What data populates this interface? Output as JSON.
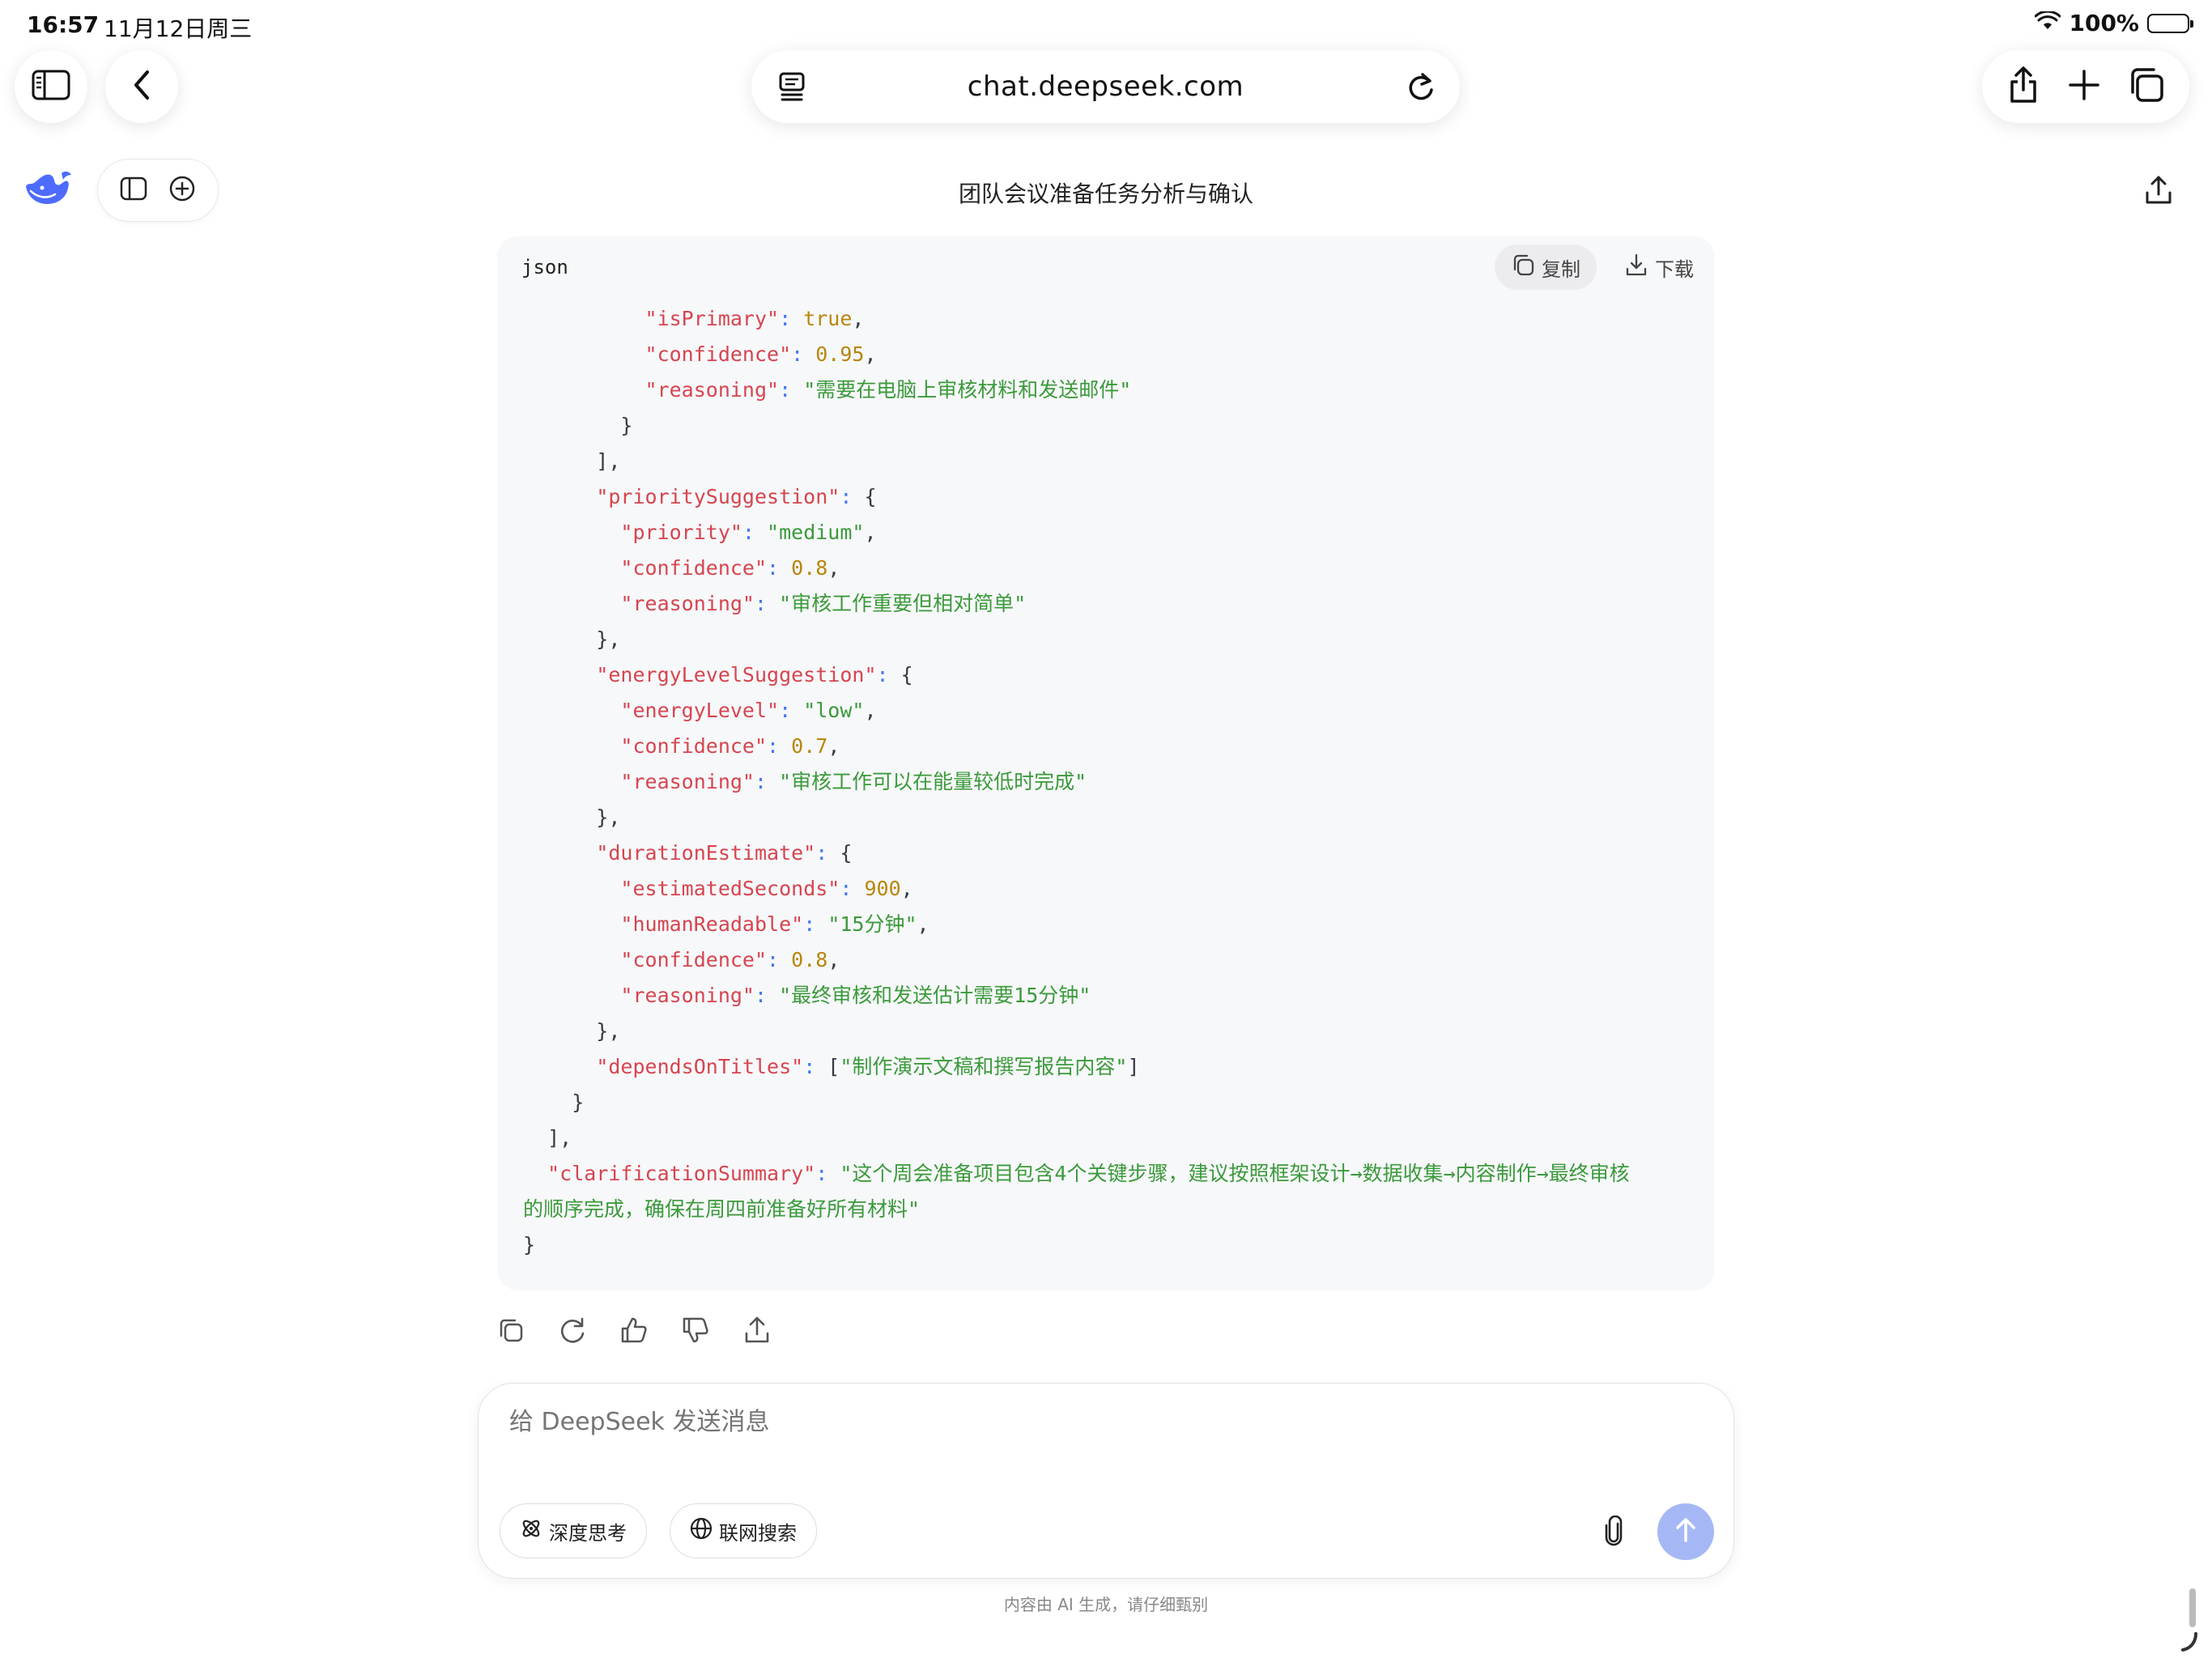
{
  "status_bar": {
    "time": "16:57",
    "date": "11月12日周三",
    "battery": "100%",
    "battery_level": 1.0
  },
  "browser": {
    "url": "chat.deepseek.com"
  },
  "chat": {
    "title": "团队会议准备任务分析与确认"
  },
  "code_block": {
    "language": "json",
    "copy_label": "复制",
    "download_label": "下载",
    "lines": [
      [
        {
          "t": "          ",
          "c": "p"
        },
        {
          "t": "\"isPrimary\"",
          "c": "k"
        },
        {
          "t": ": ",
          "c": "o"
        },
        {
          "t": "true",
          "c": "n"
        },
        {
          "t": ",",
          "c": "p"
        }
      ],
      [
        {
          "t": "          ",
          "c": "p"
        },
        {
          "t": "\"confidence\"",
          "c": "k"
        },
        {
          "t": ": ",
          "c": "o"
        },
        {
          "t": "0.95",
          "c": "n"
        },
        {
          "t": ",",
          "c": "p"
        }
      ],
      [
        {
          "t": "          ",
          "c": "p"
        },
        {
          "t": "\"reasoning\"",
          "c": "k"
        },
        {
          "t": ": ",
          "c": "o"
        },
        {
          "t": "\"需要在电脑上审核材料和发送邮件\"",
          "c": "s"
        }
      ],
      [
        {
          "t": "        }",
          "c": "p"
        }
      ],
      [
        {
          "t": "      ],",
          "c": "p"
        }
      ],
      [
        {
          "t": "      ",
          "c": "p"
        },
        {
          "t": "\"prioritySuggestion\"",
          "c": "k"
        },
        {
          "t": ": ",
          "c": "o"
        },
        {
          "t": "{",
          "c": "p"
        }
      ],
      [
        {
          "t": "        ",
          "c": "p"
        },
        {
          "t": "\"priority\"",
          "c": "k"
        },
        {
          "t": ": ",
          "c": "o"
        },
        {
          "t": "\"medium\"",
          "c": "s"
        },
        {
          "t": ",",
          "c": "p"
        }
      ],
      [
        {
          "t": "        ",
          "c": "p"
        },
        {
          "t": "\"confidence\"",
          "c": "k"
        },
        {
          "t": ": ",
          "c": "o"
        },
        {
          "t": "0.8",
          "c": "n"
        },
        {
          "t": ",",
          "c": "p"
        }
      ],
      [
        {
          "t": "        ",
          "c": "p"
        },
        {
          "t": "\"reasoning\"",
          "c": "k"
        },
        {
          "t": ": ",
          "c": "o"
        },
        {
          "t": "\"审核工作重要但相对简单\"",
          "c": "s"
        }
      ],
      [
        {
          "t": "      },",
          "c": "p"
        }
      ],
      [
        {
          "t": "      ",
          "c": "p"
        },
        {
          "t": "\"energyLevelSuggestion\"",
          "c": "k"
        },
        {
          "t": ": ",
          "c": "o"
        },
        {
          "t": "{",
          "c": "p"
        }
      ],
      [
        {
          "t": "        ",
          "c": "p"
        },
        {
          "t": "\"energyLevel\"",
          "c": "k"
        },
        {
          "t": ": ",
          "c": "o"
        },
        {
          "t": "\"low\"",
          "c": "s"
        },
        {
          "t": ",",
          "c": "p"
        }
      ],
      [
        {
          "t": "        ",
          "c": "p"
        },
        {
          "t": "\"confidence\"",
          "c": "k"
        },
        {
          "t": ": ",
          "c": "o"
        },
        {
          "t": "0.7",
          "c": "n"
        },
        {
          "t": ",",
          "c": "p"
        }
      ],
      [
        {
          "t": "        ",
          "c": "p"
        },
        {
          "t": "\"reasoning\"",
          "c": "k"
        },
        {
          "t": ": ",
          "c": "o"
        },
        {
          "t": "\"审核工作可以在能量较低时完成\"",
          "c": "s"
        }
      ],
      [
        {
          "t": "      },",
          "c": "p"
        }
      ],
      [
        {
          "t": "      ",
          "c": "p"
        },
        {
          "t": "\"durationEstimate\"",
          "c": "k"
        },
        {
          "t": ": ",
          "c": "o"
        },
        {
          "t": "{",
          "c": "p"
        }
      ],
      [
        {
          "t": "        ",
          "c": "p"
        },
        {
          "t": "\"estimatedSeconds\"",
          "c": "k"
        },
        {
          "t": ": ",
          "c": "o"
        },
        {
          "t": "900",
          "c": "n"
        },
        {
          "t": ",",
          "c": "p"
        }
      ],
      [
        {
          "t": "        ",
          "c": "p"
        },
        {
          "t": "\"humanReadable\"",
          "c": "k"
        },
        {
          "t": ": ",
          "c": "o"
        },
        {
          "t": "\"15分钟\"",
          "c": "s"
        },
        {
          "t": ",",
          "c": "p"
        }
      ],
      [
        {
          "t": "        ",
          "c": "p"
        },
        {
          "t": "\"confidence\"",
          "c": "k"
        },
        {
          "t": ": ",
          "c": "o"
        },
        {
          "t": "0.8",
          "c": "n"
        },
        {
          "t": ",",
          "c": "p"
        }
      ],
      [
        {
          "t": "        ",
          "c": "p"
        },
        {
          "t": "\"reasoning\"",
          "c": "k"
        },
        {
          "t": ": ",
          "c": "o"
        },
        {
          "t": "\"最终审核和发送估计需要15分钟\"",
          "c": "s"
        }
      ],
      [
        {
          "t": "      },",
          "c": "p"
        }
      ],
      [
        {
          "t": "      ",
          "c": "p"
        },
        {
          "t": "\"dependsOnTitles\"",
          "c": "k"
        },
        {
          "t": ": ",
          "c": "o"
        },
        {
          "t": "[",
          "c": "p"
        },
        {
          "t": "\"制作演示文稿和撰写报告内容\"",
          "c": "s"
        },
        {
          "t": "]",
          "c": "p"
        }
      ],
      [
        {
          "t": "    }",
          "c": "p"
        }
      ],
      [
        {
          "t": "  ],",
          "c": "p"
        }
      ],
      [
        {
          "t": "  ",
          "c": "p"
        },
        {
          "t": "\"clarificationSummary\"",
          "c": "k"
        },
        {
          "t": ": ",
          "c": "o"
        },
        {
          "t": "\"这个周会准备项目包含4个关键步骤，建议按照框架设计→数据收集→内容制作→最终审核",
          "c": "s"
        }
      ],
      [
        {
          "t": "的顺序完成，确保在周四前准备好所有材料\"",
          "c": "s"
        }
      ],
      [
        {
          "t": "}",
          "c": "p"
        }
      ]
    ]
  },
  "composer": {
    "placeholder": "给 DeepSeek 发送消息",
    "deep_think_label": "深度思考",
    "web_search_label": "联网搜索"
  },
  "footer": {
    "disclaimer": "内容由 AI 生成，请仔细甄别"
  },
  "colors": {
    "key": "#d6454f",
    "string": "#3b9a3b",
    "number": "#b8860b",
    "send_button": "#a5b8f5",
    "brand": "#4d6bfe"
  },
  "icons": {
    "sidebar": "sidebar-icon",
    "back": "chevron-left-icon",
    "page_menu": "page-menu-icon",
    "reload": "reload-icon",
    "share": "share-icon",
    "new_tab": "plus-icon",
    "tabs": "tabs-icon",
    "logo": "deepseek-whale-logo",
    "new_chat": "new-chat-icon",
    "copy": "copy-icon",
    "download": "download-icon",
    "regenerate": "regenerate-icon",
    "like": "thumbs-up-icon",
    "dislike": "thumbs-down-icon",
    "attach": "paperclip-icon",
    "send": "arrow-up-icon",
    "deep_think": "deep-think-icon",
    "web_search": "globe-icon"
  }
}
